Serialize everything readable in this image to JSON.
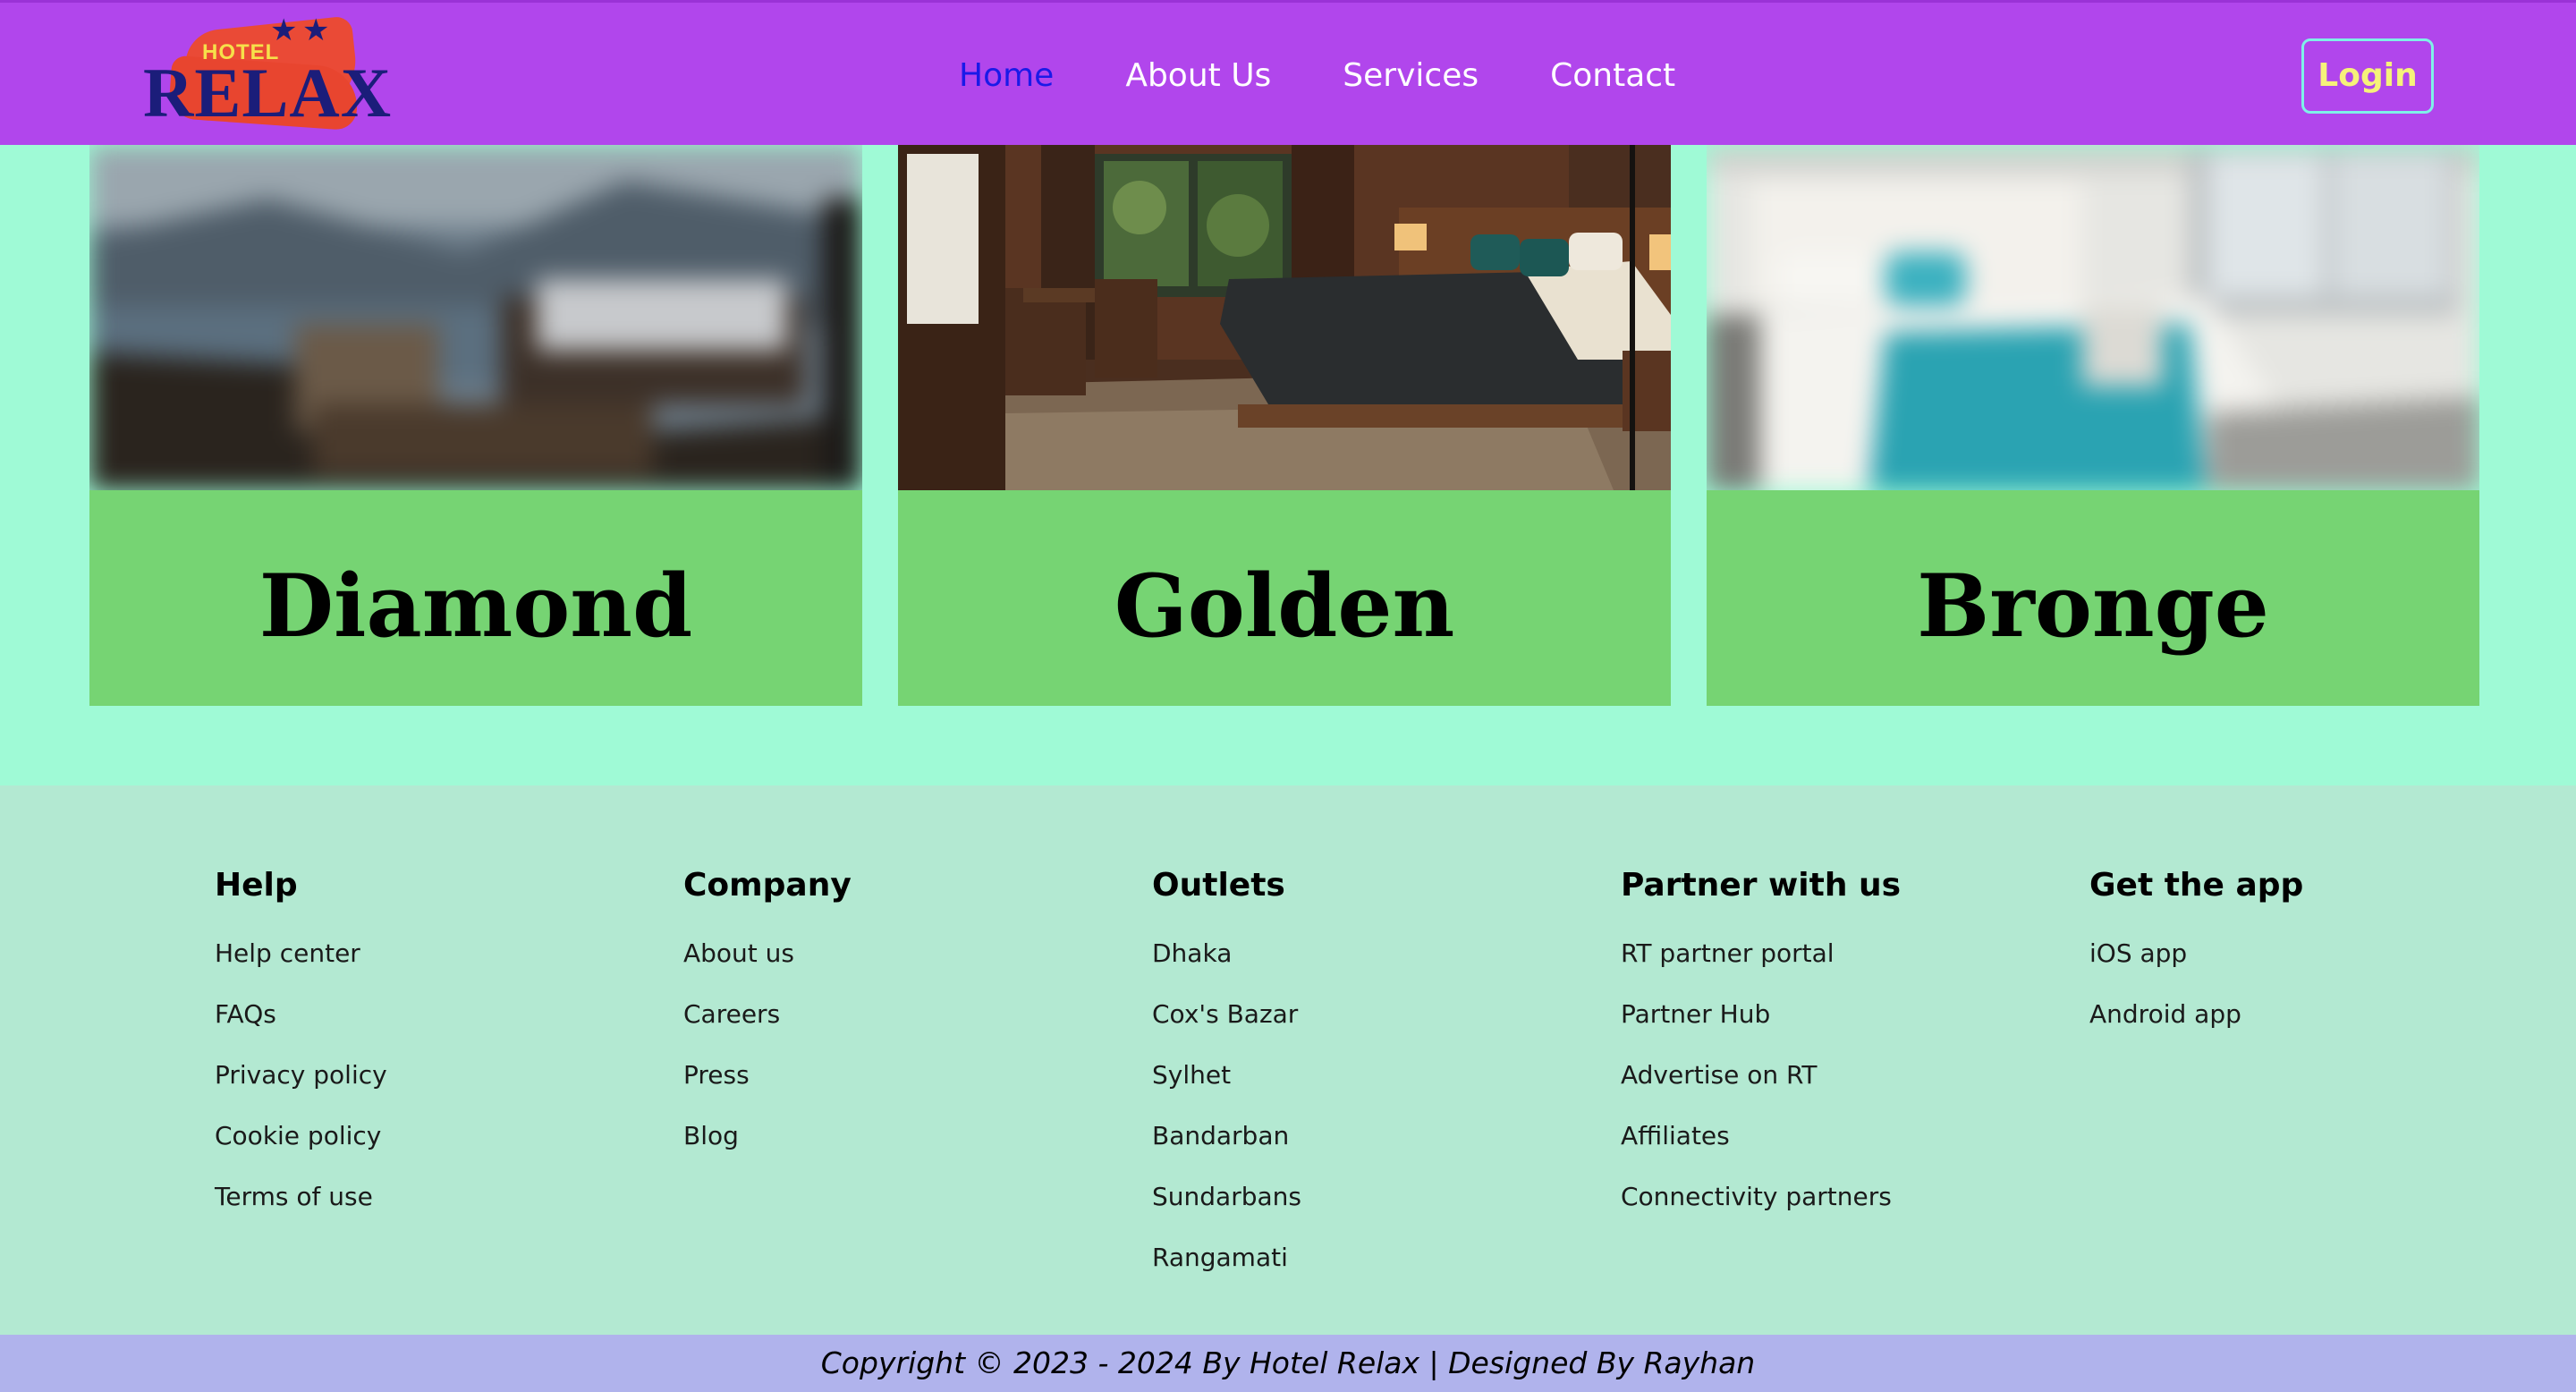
{
  "brand": {
    "logo_top": "HOTEL",
    "logo_main": "RELAX",
    "stars": "★★"
  },
  "nav": {
    "items": [
      {
        "label": "Home",
        "active": true
      },
      {
        "label": "About Us",
        "active": false
      },
      {
        "label": "Services",
        "active": false
      },
      {
        "label": "Contact",
        "active": false
      }
    ],
    "login_label": "Login"
  },
  "rooms": [
    {
      "name": "Diamond",
      "photo": "blurred-lakeside-bed-image"
    },
    {
      "name": "Golden",
      "photo": "wooden-hotel-room-image"
    },
    {
      "name": "Bronge",
      "photo": "blurred-white-teal-bed-image"
    }
  ],
  "footer": {
    "columns": [
      {
        "title": "Help",
        "links": [
          "Help center",
          "FAQs",
          "Privacy policy",
          "Cookie policy",
          "Terms of use"
        ]
      },
      {
        "title": "Company",
        "links": [
          "About us",
          "Careers",
          "Press",
          "Blog"
        ]
      },
      {
        "title": "Outlets",
        "links": [
          "Dhaka",
          "Cox's Bazar",
          "Sylhet",
          "Bandarban",
          "Sundarbans",
          "Rangamati"
        ]
      },
      {
        "title": "Partner with us",
        "links": [
          "RT partner portal",
          "Partner Hub",
          "Advertise on RT",
          "Affiliates",
          "Connectivity partners"
        ]
      },
      {
        "title": "Get the app",
        "links": [
          "iOS app",
          "Android app"
        ]
      }
    ],
    "copyright": "Copyright © 2023 - 2024 By Hotel Relax | Designed By Rayhan"
  },
  "colors": {
    "navbar": "#b146ec",
    "page_bg": "#9ffad6",
    "card_label_bg": "#76d473",
    "footer_bg": "#b3e9d2",
    "copyright_bg": "#b0b3ec",
    "nav_active": "#1a1ae8",
    "login_text": "#f6f27a"
  }
}
